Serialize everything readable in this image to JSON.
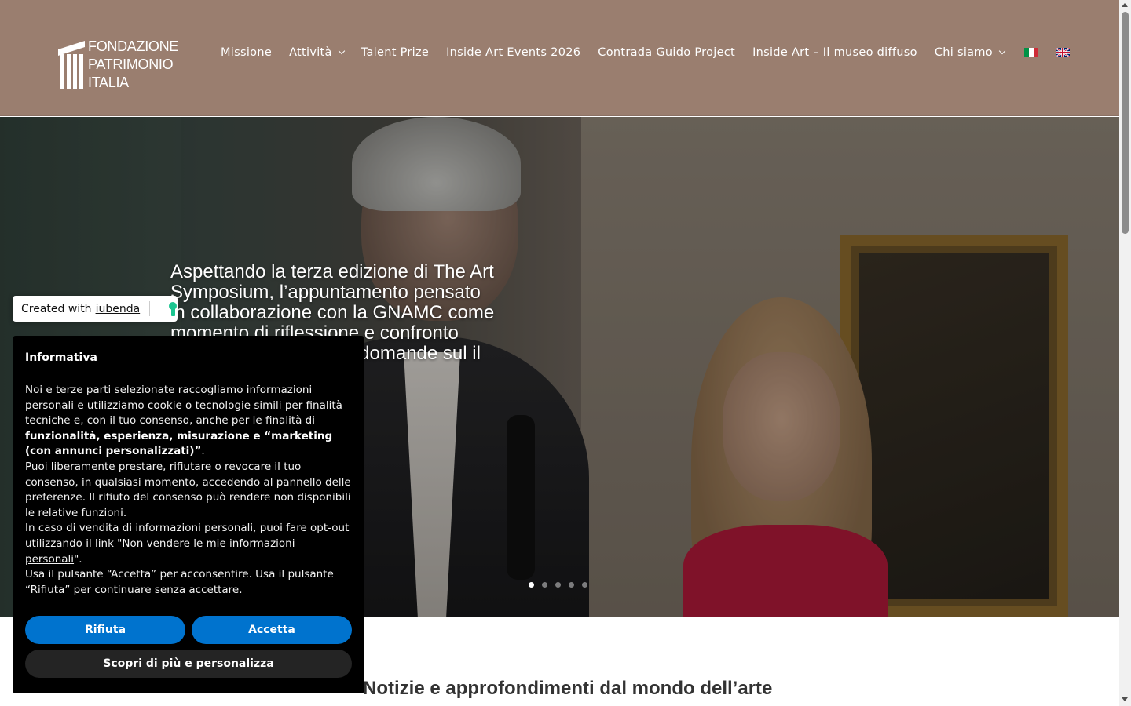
{
  "logo": {
    "lines": [
      "FONDAZIONE",
      "PATRIMONIO",
      "ITALIA"
    ]
  },
  "nav": {
    "items": [
      {
        "label": "Missione",
        "dropdown": false
      },
      {
        "label": "Attività",
        "dropdown": true
      },
      {
        "label": "Talent Prize",
        "dropdown": false
      },
      {
        "label": "Inside Art Events 2026",
        "dropdown": false
      },
      {
        "label": "Contrada Guido Project",
        "dropdown": false
      },
      {
        "label": "Inside Art – Il museo diffuso",
        "dropdown": false
      },
      {
        "label": "Chi siamo",
        "dropdown": true
      }
    ],
    "languages": [
      "it-flag-icon",
      "uk-flag-icon"
    ]
  },
  "hero": {
    "text": "Aspettando la terza edizione di The Art Symposium, l’appuntamento pensato in collaborazione con la GNAMC come momento di riflessione e confronto pubblico e intorno alle domande sul il modo di fare",
    "slides_total": 5,
    "active_slide": 1
  },
  "section": {
    "title": "Notizie e approfondimenti dal mondo dell’arte"
  },
  "iubenda_badge": {
    "prefix": "Created with",
    "link": "iubenda"
  },
  "cookie": {
    "title": "Informativa",
    "p1_start": "Noi e terze parti selezionate raccogliamo informazioni personali e utilizziamo cookie o tecnologie simili per finalità tecniche e, con il tuo consenso, anche per le finalità di ",
    "p1_bold": "funzionalità, esperienza, misurazione e “marketing (con annunci personalizzati)”",
    "p1_end": ".",
    "p2": "Puoi liberamente prestare, rifiutare o revocare il tuo consenso, in qualsiasi momento, accedendo al pannello delle preferenze. Il rifiuto del consenso può rendere non disponibili le relative funzioni.",
    "p3_start": "In caso di vendita di informazioni personali, puoi fare opt-out utilizzando il link \"",
    "p3_link": "Non vendere le mie informazioni personali",
    "p3_end": "\".",
    "p4": "Usa il pulsante “Accetta” per acconsentire. Usa il pulsante “Rifiuta” per continuare senza accettare.",
    "reject_label": "Rifiuta",
    "accept_label": "Accetta",
    "customize_label": "Scopri di più e personalizza"
  },
  "colors": {
    "header": "#9a7e6f",
    "button_blue": "#0073ce",
    "banner_bg": "#000000"
  }
}
